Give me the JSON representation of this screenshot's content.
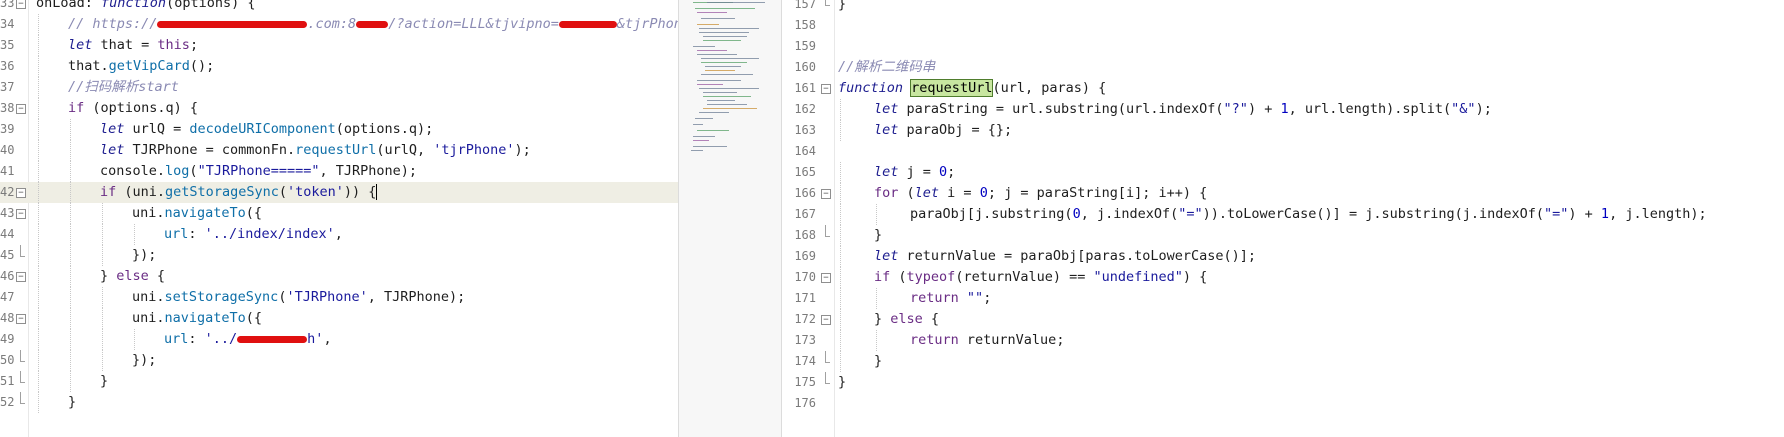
{
  "colors": {
    "background": "#ffffff",
    "current_line": "#efeee4",
    "match_highlight": "#c8e6a0",
    "redaction": "#e01010"
  },
  "left_editor": {
    "lines": [
      {
        "n": "33",
        "fold": "open",
        "segs": [
          [
            "plain",
            "onLoad: "
          ],
          [
            "kw",
            "function"
          ],
          [
            "plain",
            "(options) {"
          ]
        ]
      },
      {
        "n": "34",
        "segs": [
          [
            "cm",
            "// https://"
          ],
          [
            "redact",
            "1"
          ],
          [
            "cm",
            ".com:8"
          ],
          [
            "redact",
            "2"
          ],
          [
            "cm",
            "/?action=LLL&tjvipno="
          ],
          [
            "redact",
            "3"
          ],
          [
            "cm",
            "&tjrPhone="
          ]
        ]
      },
      {
        "n": "35",
        "segs": [
          [
            "kw",
            "let"
          ],
          [
            "plain",
            " that = "
          ],
          [
            "kw2",
            "this"
          ],
          [
            "plain",
            ";"
          ]
        ]
      },
      {
        "n": "36",
        "segs": [
          [
            "plain",
            "that."
          ],
          [
            "fn",
            "getVipCard"
          ],
          [
            "plain",
            "();"
          ]
        ]
      },
      {
        "n": "37",
        "segs": [
          [
            "cm",
            "//扫码解析start"
          ]
        ]
      },
      {
        "n": "38",
        "fold": "open",
        "segs": [
          [
            "kw2",
            "if"
          ],
          [
            "plain",
            " (options.q) {"
          ]
        ]
      },
      {
        "n": "39",
        "segs": [
          [
            "kw",
            "let"
          ],
          [
            "plain",
            " urlQ = "
          ],
          [
            "fn",
            "decodeURIComponent"
          ],
          [
            "plain",
            "(options.q);"
          ]
        ]
      },
      {
        "n": "40",
        "segs": [
          [
            "kw",
            "let"
          ],
          [
            "plain",
            " TJRPhone = commonFn."
          ],
          [
            "fn",
            "requestUrl"
          ],
          [
            "plain",
            "(urlQ, "
          ],
          [
            "str",
            "'tjrPhone'"
          ],
          [
            "plain",
            ");"
          ]
        ]
      },
      {
        "n": "41",
        "segs": [
          [
            "plain",
            "console."
          ],
          [
            "fn",
            "log"
          ],
          [
            "plain",
            "("
          ],
          [
            "str",
            "\"TJRPhone=====\""
          ],
          [
            "plain",
            ", TJRPhone);"
          ]
        ]
      },
      {
        "n": "42",
        "fold": "open",
        "current": true,
        "segs": [
          [
            "kw2",
            "if"
          ],
          [
            "plain",
            " (uni."
          ],
          [
            "fn",
            "getStorageSync"
          ],
          [
            "plain",
            "("
          ],
          [
            "str",
            "'token'"
          ],
          [
            "plain",
            ")) "
          ],
          [
            "caret",
            "{"
          ]
        ]
      },
      {
        "n": "43",
        "fold": "open",
        "segs": [
          [
            "plain",
            "uni."
          ],
          [
            "fn",
            "navigateTo"
          ],
          [
            "plain",
            "({"
          ]
        ]
      },
      {
        "n": "44",
        "segs": [
          [
            "fn",
            "url"
          ],
          [
            "plain",
            ": "
          ],
          [
            "str",
            "'../index/index'"
          ],
          [
            "plain",
            ","
          ]
        ]
      },
      {
        "n": "45",
        "fold": "end",
        "segs": [
          [
            "plain",
            "});"
          ]
        ]
      },
      {
        "n": "46",
        "fold": "open",
        "segs": [
          [
            "plain",
            "} "
          ],
          [
            "kw2",
            "else"
          ],
          [
            "plain",
            " {"
          ]
        ]
      },
      {
        "n": "47",
        "segs": [
          [
            "plain",
            "uni."
          ],
          [
            "fn",
            "setStorageSync"
          ],
          [
            "plain",
            "("
          ],
          [
            "str",
            "'TJRPhone'"
          ],
          [
            "plain",
            ", TJRPhone);"
          ]
        ]
      },
      {
        "n": "48",
        "fold": "open",
        "segs": [
          [
            "plain",
            "uni."
          ],
          [
            "fn",
            "navigateTo"
          ],
          [
            "plain",
            "({"
          ]
        ]
      },
      {
        "n": "49",
        "segs": [
          [
            "fn",
            "url"
          ],
          [
            "plain",
            ": "
          ],
          [
            "str",
            "'../"
          ],
          [
            "redact",
            "4"
          ],
          [
            "str",
            "h'"
          ],
          [
            "plain",
            ","
          ]
        ]
      },
      {
        "n": "50",
        "fold": "end",
        "segs": [
          [
            "plain",
            "});"
          ]
        ]
      },
      {
        "n": "51",
        "fold": "end",
        "segs": [
          [
            "plain",
            "}"
          ]
        ]
      },
      {
        "n": "52",
        "fold": "end",
        "segs": [
          [
            "plain",
            "}"
          ]
        ]
      }
    ]
  },
  "right_editor": {
    "lines": [
      {
        "n": "157",
        "fold": "end",
        "segs": [
          [
            "plain",
            "}"
          ]
        ]
      },
      {
        "n": "158",
        "segs": []
      },
      {
        "n": "159",
        "segs": []
      },
      {
        "n": "160",
        "segs": [
          [
            "cm",
            "//解析二维码串"
          ]
        ]
      },
      {
        "n": "161",
        "fold": "open",
        "segs": [
          [
            "kw",
            "function"
          ],
          [
            "plain",
            " "
          ],
          [
            "match",
            "requestUrl"
          ],
          [
            "plain",
            "(url, paras) {"
          ]
        ]
      },
      {
        "n": "162",
        "segs": [
          [
            "kw",
            "let"
          ],
          [
            "plain",
            " paraString = url."
          ],
          [
            "plain",
            "substring"
          ],
          [
            "plain",
            "(url."
          ],
          [
            "plain",
            "indexOf"
          ],
          [
            "plain",
            "("
          ],
          [
            "str",
            "\"?\""
          ],
          [
            "plain",
            ") + "
          ],
          [
            "num",
            "1"
          ],
          [
            "plain",
            ", url.length)."
          ],
          [
            "plain",
            "split"
          ],
          [
            "plain",
            "("
          ],
          [
            "str",
            "\"&\""
          ],
          [
            "plain",
            ");"
          ]
        ]
      },
      {
        "n": "163",
        "segs": [
          [
            "kw",
            "let"
          ],
          [
            "plain",
            " paraObj = {};"
          ]
        ]
      },
      {
        "n": "164",
        "segs": []
      },
      {
        "n": "165",
        "segs": [
          [
            "kw",
            "let"
          ],
          [
            "plain",
            " j = "
          ],
          [
            "num",
            "0"
          ],
          [
            "plain",
            ";"
          ]
        ]
      },
      {
        "n": "166",
        "fold": "open",
        "segs": [
          [
            "kw2",
            "for"
          ],
          [
            "plain",
            " ("
          ],
          [
            "kw",
            "let"
          ],
          [
            "plain",
            " i = "
          ],
          [
            "num",
            "0"
          ],
          [
            "plain",
            "; j = paraString[i]; i++) {"
          ]
        ]
      },
      {
        "n": "167",
        "segs": [
          [
            "plain",
            "paraObj[j.substring("
          ],
          [
            "num",
            "0"
          ],
          [
            "plain",
            ", j.indexOf("
          ],
          [
            "str",
            "\"=\""
          ],
          [
            "plain",
            ")).toLowerCase()] = j.substring(j.indexOf("
          ],
          [
            "str",
            "\"=\""
          ],
          [
            "plain",
            ") + "
          ],
          [
            "num",
            "1"
          ],
          [
            "plain",
            ", j.length);"
          ]
        ]
      },
      {
        "n": "168",
        "fold": "end",
        "segs": [
          [
            "plain",
            "}"
          ]
        ]
      },
      {
        "n": "169",
        "segs": [
          [
            "kw",
            "let"
          ],
          [
            "plain",
            " returnValue = paraObj[paras.toLowerCase()];"
          ]
        ]
      },
      {
        "n": "170",
        "fold": "open",
        "segs": [
          [
            "kw2",
            "if"
          ],
          [
            "plain",
            " ("
          ],
          [
            "kw2",
            "typeof"
          ],
          [
            "plain",
            "(returnValue) == "
          ],
          [
            "str",
            "\"undefined\""
          ],
          [
            "plain",
            ") {"
          ]
        ]
      },
      {
        "n": "171",
        "segs": [
          [
            "kw2",
            "return"
          ],
          [
            "plain",
            " "
          ],
          [
            "str",
            "\"\""
          ],
          [
            "plain",
            ";"
          ]
        ]
      },
      {
        "n": "172",
        "fold": "open",
        "segs": [
          [
            "plain",
            "} "
          ],
          [
            "kw2",
            "else"
          ],
          [
            "plain",
            " {"
          ]
        ]
      },
      {
        "n": "173",
        "segs": [
          [
            "kw2",
            "return"
          ],
          [
            "plain",
            " returnValue;"
          ]
        ]
      },
      {
        "n": "174",
        "fold": "end",
        "segs": [
          [
            "plain",
            "}"
          ]
        ]
      },
      {
        "n": "175",
        "fold": "end",
        "segs": [
          [
            "plain",
            "}"
          ]
        ]
      },
      {
        "n": "176",
        "segs": []
      }
    ]
  }
}
